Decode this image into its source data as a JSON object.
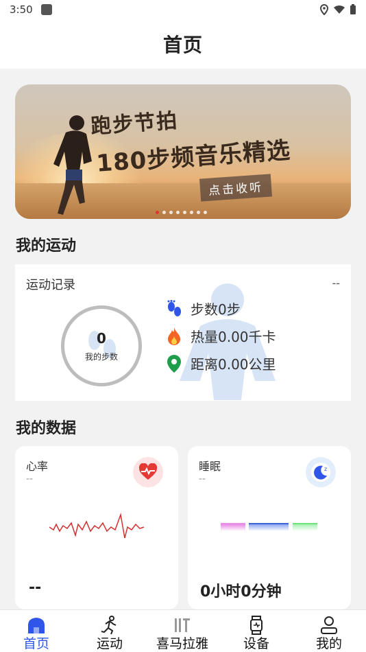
{
  "status_bar": {
    "time": "3:50"
  },
  "header": {
    "title": "首页"
  },
  "banner": {
    "title_line1": "跑步节拍",
    "title_line2": "180步频音乐精选",
    "button": "点击收听",
    "dot_count": 8,
    "active_dot": 0
  },
  "sport": {
    "section_title": "我的运动",
    "card_title": "运动记录",
    "card_dash": "--",
    "steps_value": "0",
    "steps_label": "我的步数",
    "stats": {
      "steps": "步数0步",
      "calories": "热量0.00千卡",
      "distance": "距离0.00公里"
    }
  },
  "data": {
    "section_title": "我的数据",
    "heart": {
      "title": "心率",
      "sub": "--",
      "value": "--",
      "color": "#e53935"
    },
    "sleep": {
      "title": "睡眠",
      "sub": "--",
      "value": "0小时0分钟",
      "colors": [
        "#e98ce6",
        "#3f64d8",
        "#6fe07a"
      ]
    }
  },
  "tabs": [
    {
      "label": "首页",
      "icon": "home-icon",
      "active": true
    },
    {
      "label": "运动",
      "icon": "runner-icon",
      "active": false
    },
    {
      "label": "喜马拉雅",
      "icon": "ximalaya-icon",
      "active": false
    },
    {
      "label": "设备",
      "icon": "watch-icon",
      "active": false
    },
    {
      "label": "我的",
      "icon": "user-icon",
      "active": false
    }
  ],
  "colors": {
    "accent": "#2f56e8",
    "steps_icon": "#2f56e8",
    "fire_icon": "#f26522",
    "location_icon": "#1f9d4a"
  }
}
